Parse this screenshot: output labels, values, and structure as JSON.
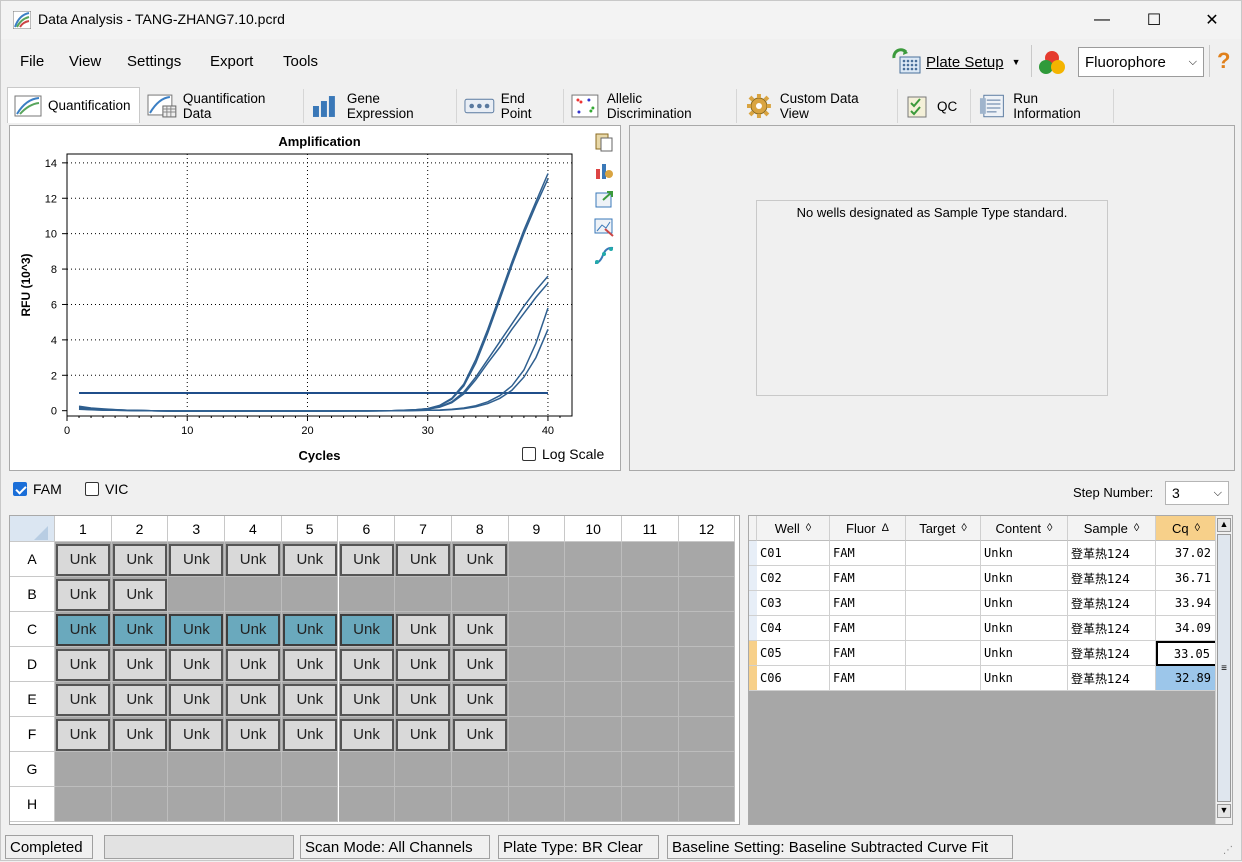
{
  "window": {
    "title": "Data Analysis - TANG-ZHANG7.10.pcrd",
    "minimize": "—",
    "maximize": "☐",
    "close": "✕"
  },
  "menu": {
    "file": "File",
    "view": "View",
    "settings": "Settings",
    "export": "Export",
    "tools": "Tools",
    "plate_setup": "Plate Setup",
    "fluorophore": "Fluorophore",
    "help": "?"
  },
  "tabs": [
    {
      "label": "Quantification",
      "icon": "amplification-icon"
    },
    {
      "label": "Quantification Data",
      "icon": "data-icon"
    },
    {
      "label": "Gene Expression",
      "icon": "bar-chart-icon"
    },
    {
      "label": "End Point",
      "icon": "end-point-icon"
    },
    {
      "label": "Allelic Discrimination",
      "icon": "scatter-icon"
    },
    {
      "label": "Custom Data View",
      "icon": "gear-icon"
    },
    {
      "label": "QC",
      "icon": "qc-icon"
    },
    {
      "label": "Run Information",
      "icon": "info-icon"
    }
  ],
  "chart_data": {
    "type": "line",
    "title": "Amplification",
    "xlabel": "Cycles",
    "ylabel": "RFU (10^3)",
    "xlim": [
      0,
      42
    ],
    "ylim": [
      -0.3,
      14.5
    ],
    "xticks": [
      0,
      10,
      20,
      30,
      40
    ],
    "yticks": [
      0,
      2,
      4,
      6,
      8,
      10,
      12,
      14
    ],
    "grid": true,
    "threshold": 1.0,
    "threshold_x": [
      1,
      40
    ],
    "x": [
      1,
      2,
      3,
      4,
      5,
      6,
      7,
      8,
      9,
      10,
      11,
      12,
      13,
      14,
      15,
      16,
      17,
      18,
      19,
      20,
      21,
      22,
      23,
      24,
      25,
      26,
      27,
      28,
      29,
      30,
      31,
      32,
      33,
      34,
      35,
      36,
      37,
      38,
      39,
      40
    ],
    "series": [
      {
        "values": [
          0.25,
          0.15,
          0.1,
          0.06,
          0.03,
          0.01,
          0,
          -0.01,
          -0.02,
          -0.02,
          -0.02,
          -0.02,
          -0.02,
          -0.02,
          -0.02,
          -0.02,
          -0.02,
          -0.02,
          -0.02,
          -0.02,
          -0.02,
          -0.02,
          -0.01,
          -0.01,
          -0.01,
          0,
          0,
          0.02,
          0.05,
          0.12,
          0.3,
          0.7,
          1.5,
          2.9,
          4.6,
          6.5,
          8.4,
          10.2,
          11.8,
          13.4
        ]
      },
      {
        "values": [
          0.2,
          0.12,
          0.08,
          0.05,
          0.02,
          0.01,
          0,
          -0.01,
          -0.02,
          -0.02,
          -0.02,
          -0.02,
          -0.02,
          -0.02,
          -0.02,
          -0.02,
          -0.02,
          -0.02,
          -0.02,
          -0.02,
          -0.02,
          -0.02,
          -0.01,
          -0.01,
          -0.01,
          0,
          0,
          0.02,
          0.05,
          0.11,
          0.28,
          0.65,
          1.4,
          2.7,
          4.4,
          6.3,
          8.2,
          10.0,
          11.6,
          13.1
        ]
      },
      {
        "values": [
          0.15,
          0.1,
          0.07,
          0.04,
          0.02,
          0.01,
          0,
          -0.01,
          -0.02,
          -0.02,
          -0.02,
          -0.02,
          -0.02,
          -0.02,
          -0.02,
          -0.02,
          -0.02,
          -0.02,
          -0.02,
          -0.02,
          -0.02,
          -0.02,
          -0.01,
          -0.01,
          -0.01,
          0,
          0,
          0.01,
          0.04,
          0.1,
          0.22,
          0.5,
          1.05,
          1.9,
          2.9,
          3.9,
          4.9,
          5.9,
          6.8,
          7.6
        ]
      },
      {
        "values": [
          0.12,
          0.08,
          0.05,
          0.03,
          0.02,
          0.01,
          0,
          -0.01,
          -0.02,
          -0.02,
          -0.02,
          -0.02,
          -0.02,
          -0.02,
          -0.02,
          -0.02,
          -0.02,
          -0.02,
          -0.02,
          -0.02,
          -0.02,
          -0.02,
          -0.01,
          -0.01,
          -0.01,
          0,
          0,
          0.01,
          0.03,
          0.09,
          0.2,
          0.45,
          0.95,
          1.75,
          2.7,
          3.6,
          4.6,
          5.5,
          6.4,
          7.2
        ]
      },
      {
        "values": [
          0.1,
          0.06,
          0.04,
          0.02,
          0.01,
          0,
          0,
          -0.01,
          -0.02,
          -0.02,
          -0.02,
          -0.02,
          -0.02,
          -0.02,
          -0.02,
          -0.02,
          -0.02,
          -0.02,
          -0.02,
          -0.02,
          -0.02,
          -0.02,
          -0.02,
          -0.01,
          -0.01,
          -0.01,
          0,
          0,
          0.01,
          0.02,
          0.04,
          0.08,
          0.15,
          0.28,
          0.5,
          0.85,
          1.4,
          2.3,
          3.8,
          5.8
        ]
      },
      {
        "values": [
          0.08,
          0.05,
          0.03,
          0.02,
          0.01,
          0,
          0,
          -0.01,
          -0.02,
          -0.02,
          -0.02,
          -0.02,
          -0.02,
          -0.02,
          -0.02,
          -0.02,
          -0.02,
          -0.02,
          -0.02,
          -0.02,
          -0.02,
          -0.02,
          -0.02,
          -0.01,
          -0.01,
          -0.01,
          0,
          0,
          0.01,
          0.02,
          0.03,
          0.06,
          0.12,
          0.22,
          0.4,
          0.7,
          1.15,
          1.9,
          3.0,
          4.6
        ]
      }
    ]
  },
  "chart_side": {
    "log_scale": "Log Scale",
    "log_scale_checked": false
  },
  "standard_panel": {
    "message": "No wells designated as Sample Type standard."
  },
  "fluor_filter": {
    "fam": "FAM",
    "fam_checked": true,
    "vic": "VIC",
    "vic_checked": false,
    "step_label": "Step Number:",
    "step_value": "3"
  },
  "plate": {
    "columns": [
      "1",
      "2",
      "3",
      "4",
      "5",
      "6",
      "7",
      "8",
      "9",
      "10",
      "11",
      "12"
    ],
    "rows": [
      "A",
      "B",
      "C",
      "D",
      "E",
      "F",
      "G",
      "H"
    ],
    "wells": {
      "A": [
        "Unk",
        "Unk",
        "Unk",
        "Unk",
        "Unk",
        "Unk",
        "Unk",
        "Unk"
      ],
      "B": [
        "Unk",
        "Unk"
      ],
      "C": [
        "Unk",
        "Unk",
        "Unk",
        "Unk",
        "Unk",
        "Unk",
        "Unk",
        "Unk"
      ],
      "D": [
        "Unk",
        "Unk",
        "Unk",
        "Unk",
        "Unk",
        "Unk",
        "Unk",
        "Unk"
      ],
      "E": [
        "Unk",
        "Unk",
        "Unk",
        "Unk",
        "Unk",
        "Unk",
        "Unk",
        "Unk"
      ],
      "F": [
        "Unk",
        "Unk",
        "Unk",
        "Unk",
        "Unk",
        "Unk",
        "Unk",
        "Unk"
      ],
      "G": [],
      "H": []
    },
    "selected_row": "C",
    "selected_count": 6
  },
  "table": {
    "headers": [
      "Well",
      "Fluor",
      "Target",
      "Content",
      "Sample",
      "Cq"
    ],
    "sort_icons": [
      "◊",
      "Δ",
      "◊",
      "◊",
      "◊",
      "◊"
    ],
    "rows": [
      {
        "well": "C01",
        "fluor": "FAM",
        "target": "",
        "content": "Unkn",
        "sample": "登革热124",
        "cq": "37.02"
      },
      {
        "well": "C02",
        "fluor": "FAM",
        "target": "",
        "content": "Unkn",
        "sample": "登革热124",
        "cq": "36.71"
      },
      {
        "well": "C03",
        "fluor": "FAM",
        "target": "",
        "content": "Unkn",
        "sample": "登革热124",
        "cq": "33.94"
      },
      {
        "well": "C04",
        "fluor": "FAM",
        "target": "",
        "content": "Unkn",
        "sample": "登革热124",
        "cq": "34.09"
      },
      {
        "well": "C05",
        "fluor": "FAM",
        "target": "",
        "content": "Unkn",
        "sample": "登革热124",
        "cq": "33.05"
      },
      {
        "well": "C06",
        "fluor": "FAM",
        "target": "",
        "content": "Unkn",
        "sample": "登革热124",
        "cq": "32.89"
      }
    ]
  },
  "status": {
    "state": "Completed",
    "scan_mode": "Scan Mode: All Channels",
    "plate_type": "Plate Type: BR Clear",
    "baseline": "Baseline Setting: Baseline Subtracted Curve Fit"
  },
  "colors": {
    "curve": "#2f5f8f",
    "selected_well": "#6aa9bd",
    "selected_cq": "#9cc6ea",
    "cq_header": "#f7d08a"
  }
}
